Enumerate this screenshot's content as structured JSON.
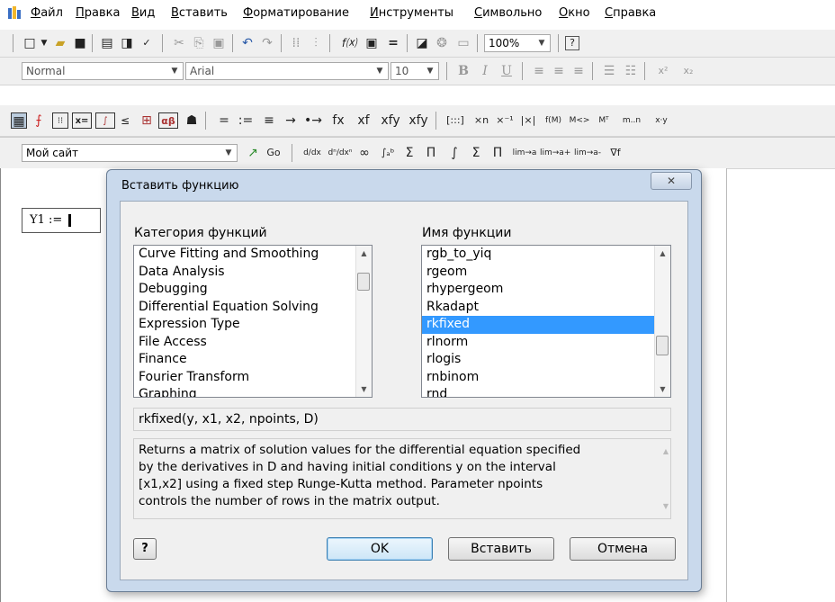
{
  "menubar": {
    "items": [
      {
        "hot": "Ф",
        "rest": "айл"
      },
      {
        "hot": "П",
        "rest": "равка"
      },
      {
        "hot": "В",
        "rest": "ид"
      },
      {
        "hot": "В",
        "rest": "ставить"
      },
      {
        "hot": "Ф",
        "rest": "орматирование"
      },
      {
        "hot": "И",
        "rest": "нструменты"
      },
      {
        "hot": "С",
        "rest": "имвольно"
      },
      {
        "hot": "О",
        "rest": "кно"
      },
      {
        "hot": "С",
        "rest": "правка"
      }
    ]
  },
  "toolbar_standard": {
    "zoom": "100%",
    "help_glyph": "?"
  },
  "toolbar_format": {
    "style": "Normal",
    "font": "Arial",
    "size": "10",
    "bold": "B",
    "italic": "I",
    "underline": "U",
    "superscript": "x²",
    "subscript": "x₂"
  },
  "toolbar_math": {
    "ops": [
      "=",
      ":=",
      "≡",
      "→",
      "•→",
      "fx",
      "xf",
      "xfy",
      "xfy"
    ],
    "matrix": [
      "[:::]",
      "×n",
      "×⁻¹",
      "|×|",
      "f(M)",
      "M<>",
      "Mᵀ",
      "m..n",
      "x·y"
    ]
  },
  "toolbar_resources": {
    "site": "Мой сайт",
    "go": "Go",
    "calculus": [
      "d/dx",
      "dⁿ/dxⁿ",
      "∞",
      "∫ₐᵇ",
      "Σ",
      "Π",
      "∫",
      "Σ",
      "Π",
      "lim→a",
      "lim→a+",
      "lim→a-",
      "∇f"
    ]
  },
  "worksheet": {
    "expression": "Y1 :="
  },
  "dialog": {
    "title": "Вставить функцию",
    "category_label": "Категория функций",
    "name_label": "Имя функции",
    "categories": [
      "Curve Fitting and Smoothing",
      "Data Analysis",
      "Debugging",
      "Differential Equation Solving",
      "Expression Type",
      "File Access",
      "Finance",
      "Fourier Transform",
      "Graphing"
    ],
    "functions": [
      "rgb_to_yiq",
      "rgeom",
      "rhypergeom",
      "Rkadapt",
      "rkfixed",
      "rlnorm",
      "rlogis",
      "rnbinom",
      "rnd"
    ],
    "selected_function": "rkfixed",
    "signature": "rkfixed(y, x1, x2, npoints, D)",
    "description": [
      "Returns a matrix of solution values for the differential equation specified",
      "by the derivatives in D and having initial conditions y on the interval",
      "[x1,x2] using a fixed step Runge-Kutta method. Parameter npoints",
      "controls the number of rows in the matrix output."
    ],
    "help_glyph": "?",
    "ok": "OK",
    "insert": "Вставить",
    "cancel": "Отмена",
    "close_glyph": "✕"
  }
}
